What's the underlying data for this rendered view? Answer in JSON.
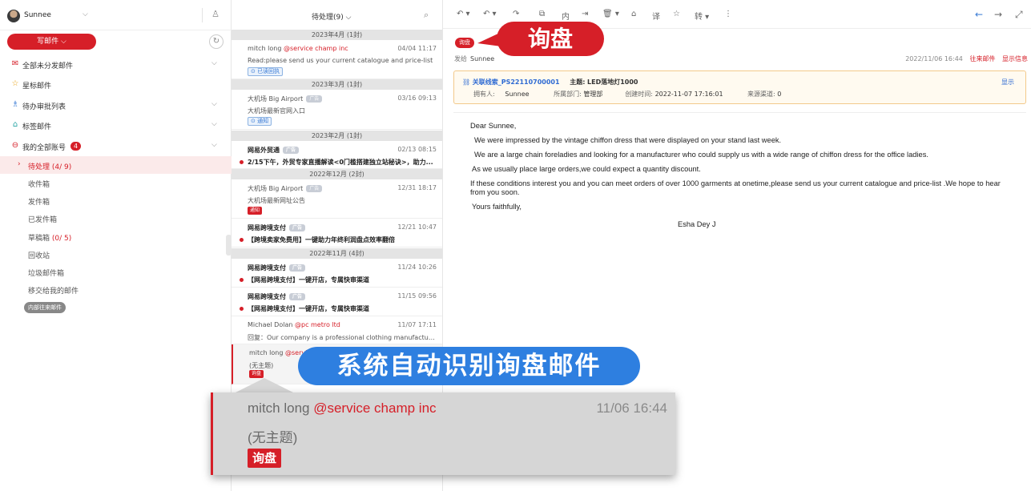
{
  "user": {
    "name": "Sunnee"
  },
  "sidebar": {
    "compose_label": "写邮件",
    "nav": [
      {
        "label": "全部未分发邮件"
      },
      {
        "label": "星标邮件"
      },
      {
        "label": "待办审批列表"
      },
      {
        "label": "标签邮件"
      },
      {
        "label": "我的全部账号",
        "badge": "4"
      }
    ],
    "folders": [
      {
        "label": "待处理",
        "count": "(4/ 9)"
      },
      {
        "label": "收件箱"
      },
      {
        "label": "发件箱"
      },
      {
        "label": "已发件箱"
      },
      {
        "label": "草稿箱",
        "count": "(0/ 5)"
      },
      {
        "label": "回收站"
      },
      {
        "label": "垃圾邮件箱"
      },
      {
        "label": "移交给我的邮件"
      }
    ],
    "internal_tag": "内部往来邮件"
  },
  "list": {
    "title": "待处理(9)",
    "groups": [
      "2023年4月 (1封)",
      "2023年3月 (1封)",
      "2023年2月 (1封)",
      "2022年12月 (2封)",
      "2022年11月 (4封)"
    ],
    "mails": [
      {
        "from": "mitch long",
        "company": "@service champ inc",
        "date": "04/04 11:17",
        "subject": "Read:please send us your current catalogue and price-list",
        "chip": "已读回执"
      },
      {
        "from": "大机场 Big Airport",
        "ad": "广告",
        "date": "03/16 09:13",
        "subject": "大机场最新官网入口",
        "chip": "通知"
      },
      {
        "from": "网易外贸通",
        "ad": "广告",
        "date": "02/13 08:15",
        "subject": "2/15下午，外贸专家直播解读<0门槛搭建独立站秘诀>，助力..."
      },
      {
        "from": "大机场 Big Airport",
        "ad": "广告",
        "date": "12/31 18:17",
        "subject": "大机场最新网址公告",
        "tag": "通知"
      },
      {
        "from": "网易跨境支付",
        "ad": "广告",
        "date": "12/21 10:47",
        "subject": "【跨境卖家免费用】一键助力年终利润盘点效率翻倍"
      },
      {
        "from": "网易跨境支付",
        "ad": "广告",
        "date": "11/24 10:26",
        "subject": "【网易跨境支付】一键开店，专属快审渠道"
      },
      {
        "from": "网易跨境支付",
        "ad": "广告",
        "date": "11/15 09:56",
        "subject": "【网易跨境支付】一键开店，专属快审渠道"
      },
      {
        "from": "Michael Dolan",
        "company": "@pc metro ltd",
        "date": "11/07 17:11",
        "subject": "回复：Our company is a professional clothing manufacturer ..."
      },
      {
        "from": "mitch long",
        "company": "@servic",
        "subject": "(无主题)",
        "tag": "询盘"
      }
    ]
  },
  "toolbar": {
    "labels": [
      "内",
      "译",
      "转"
    ]
  },
  "reader": {
    "tag": "询盘",
    "sender_label": "发给",
    "sender_name": "Sunnee",
    "datetime": "2022/11/06 16:44",
    "link1": "往来邮件",
    "link2": "显示信息",
    "lead": {
      "link": "关联线索_PS22110700001",
      "subject_label": "主题:",
      "subject": "LED落地灯1000",
      "show": "显示",
      "owner_label": "拥有人:",
      "owner": "Sunnee",
      "dept_label": "所属部门:",
      "dept": "管理部",
      "created_label": "创建时间:",
      "created": "2022-11-07 17:16:01",
      "source_label": "来源渠道:",
      "source": "0"
    },
    "body": [
      "Dear Sunnee,",
      "We were impressed by the vintage chiffon dress that were displayed on your stand last week.",
      "We are a large chain foreladies and looking for a manufacturer who could supply us with a wide range of chiffon dress for the office ladies.",
      "As we usually place large orders,we could expect a quantity discount.",
      "If these conditions interest you and you can meet orders of over 1000 garments at onetime,please send us your current catalogue and price-list .We hope to hear from you soon.",
      "Yours faithfully,",
      "Esha Dey J"
    ]
  },
  "callouts": {
    "top": "询盘",
    "bottom": "系统自动识别询盘邮件"
  },
  "zoom": {
    "from": "mitch long",
    "company": "@service champ inc",
    "date": "11/06 16:44",
    "subject": "(无主题)",
    "tag": "询盘"
  },
  "colors": {
    "brand": "#d61f28",
    "link": "#2f6bd3",
    "callout_blue": "#2e7fe0"
  }
}
